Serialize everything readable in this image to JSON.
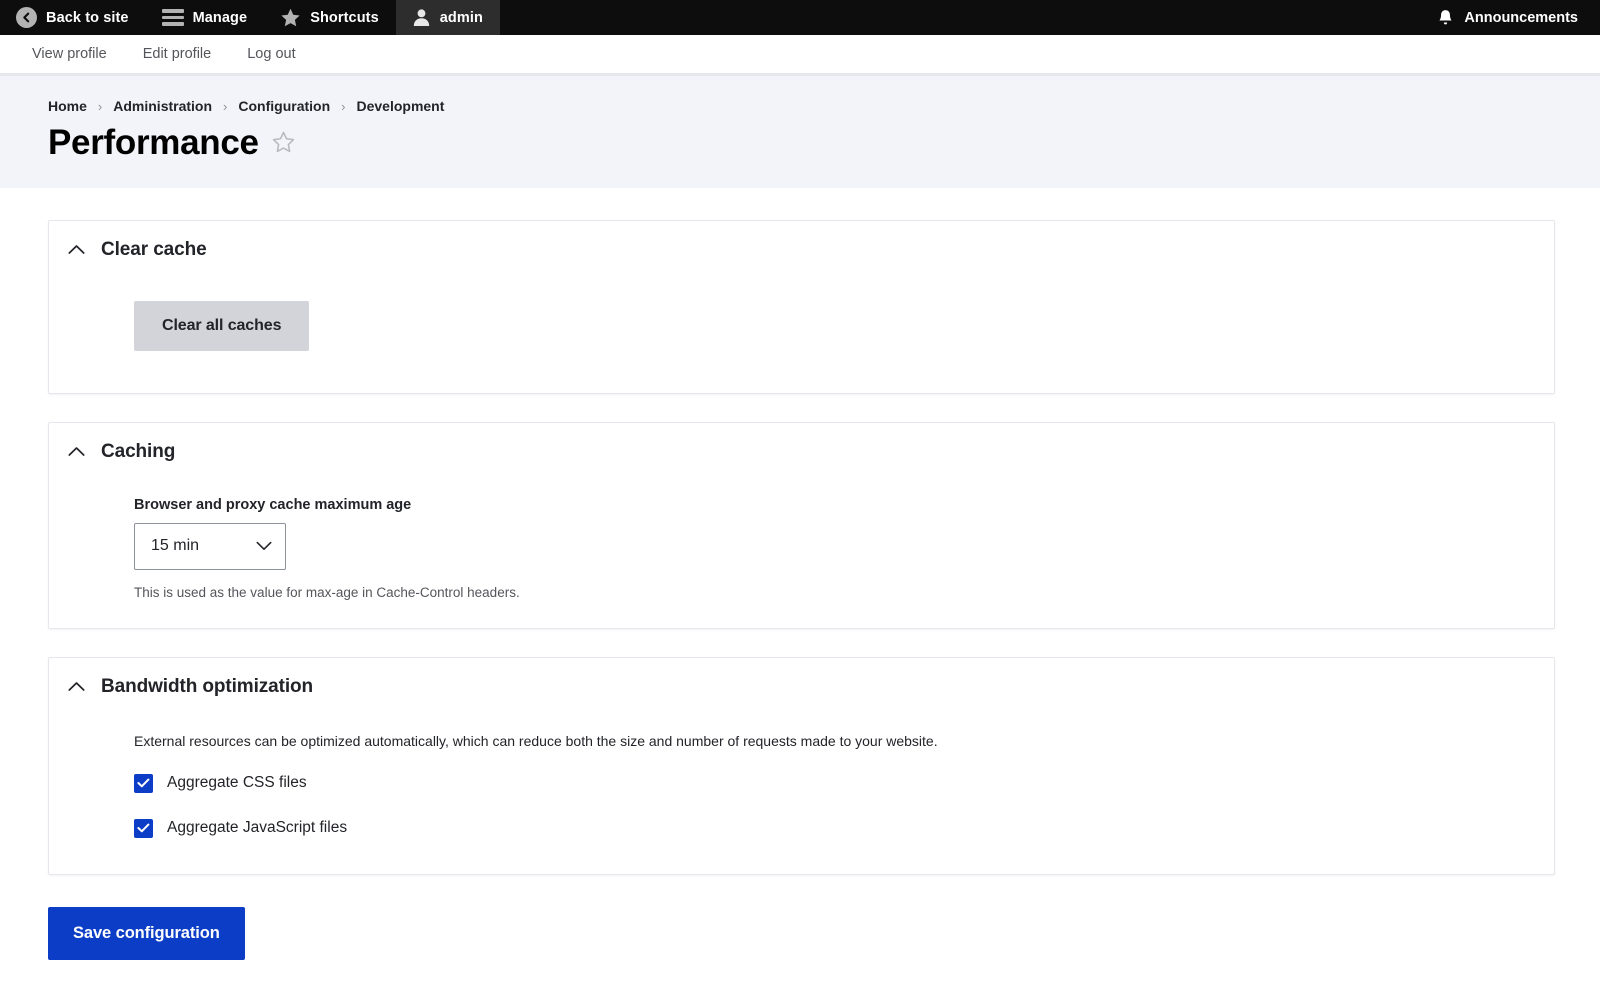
{
  "toolbar": {
    "items": [
      {
        "label": "Back to site",
        "icon": "back-circle-icon",
        "active": false
      },
      {
        "label": "Manage",
        "icon": "hamburger-icon",
        "active": false
      },
      {
        "label": "Shortcuts",
        "icon": "star-icon",
        "active": false
      },
      {
        "label": "admin",
        "icon": "person-icon",
        "active": true
      }
    ],
    "announcements_label": "Announcements",
    "announcements_icon": "bell-icon",
    "background": "#0d0d0d",
    "active_background": "#2d2d2d"
  },
  "user_menu": {
    "items": [
      {
        "label": "View profile"
      },
      {
        "label": "Edit profile"
      },
      {
        "label": "Log out"
      }
    ]
  },
  "page_header": {
    "breadcrumb": [
      "Home",
      "Administration",
      "Configuration",
      "Development"
    ],
    "separator": "›",
    "title": "Performance",
    "favorite_icon": "star-outline-icon",
    "background": "#f3f4f9"
  },
  "sections": [
    {
      "id": "clear-cache",
      "title": "Clear cache",
      "toggle_icon": "chevron-up-icon",
      "button_label": "Clear all caches"
    },
    {
      "id": "caching",
      "title": "Caching",
      "toggle_icon": "chevron-up-icon",
      "field_label": "Browser and proxy cache maximum age",
      "field_value": "15 min",
      "field_icon": "chevron-down-icon",
      "field_description": "This is used as the value for max-age in Cache-Control headers."
    },
    {
      "id": "bandwidth-optimization",
      "title": "Bandwidth optimization",
      "toggle_icon": "chevron-up-icon",
      "description": "External resources can be optimized automatically, which can reduce both the size and number of requests made to your website.",
      "checkboxes": [
        {
          "label": "Aggregate CSS files",
          "checked": true
        },
        {
          "label": "Aggregate JavaScript files",
          "checked": true
        }
      ]
    }
  ],
  "actions": {
    "save_label": "Save configuration"
  },
  "colors": {
    "primary": "#0b3dc7",
    "secondary_button": "#d3d4d9",
    "header_bg": "#f3f4f9",
    "toolbar_bg": "#0d0d0d"
  }
}
